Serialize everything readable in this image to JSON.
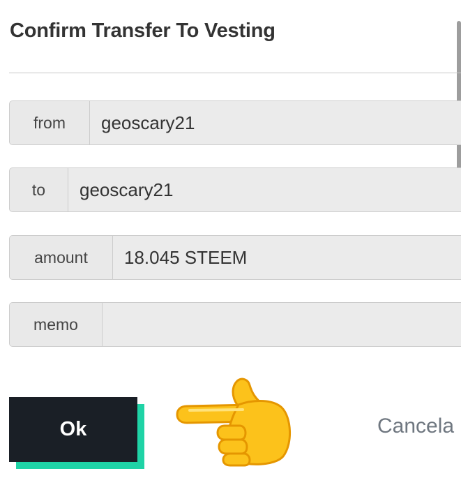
{
  "dialog": {
    "title": "Confirm Transfer To Vesting"
  },
  "fields": {
    "from": {
      "label": "from",
      "value": "geoscary21"
    },
    "to": {
      "label": "to",
      "value": "geoscary21"
    },
    "amount": {
      "label": "amount",
      "value": "18.045 STEEM"
    },
    "memo": {
      "label": "memo",
      "value": ""
    }
  },
  "actions": {
    "ok_label": "Ok",
    "cancel_label": "Cancela"
  },
  "decoration": {
    "pointer_icon": "backhand-index-pointing-right-emoji"
  },
  "colors": {
    "ok_background": "#1a1f26",
    "ok_shadow": "#1fd3a6",
    "field_background": "#e9e9e9"
  }
}
